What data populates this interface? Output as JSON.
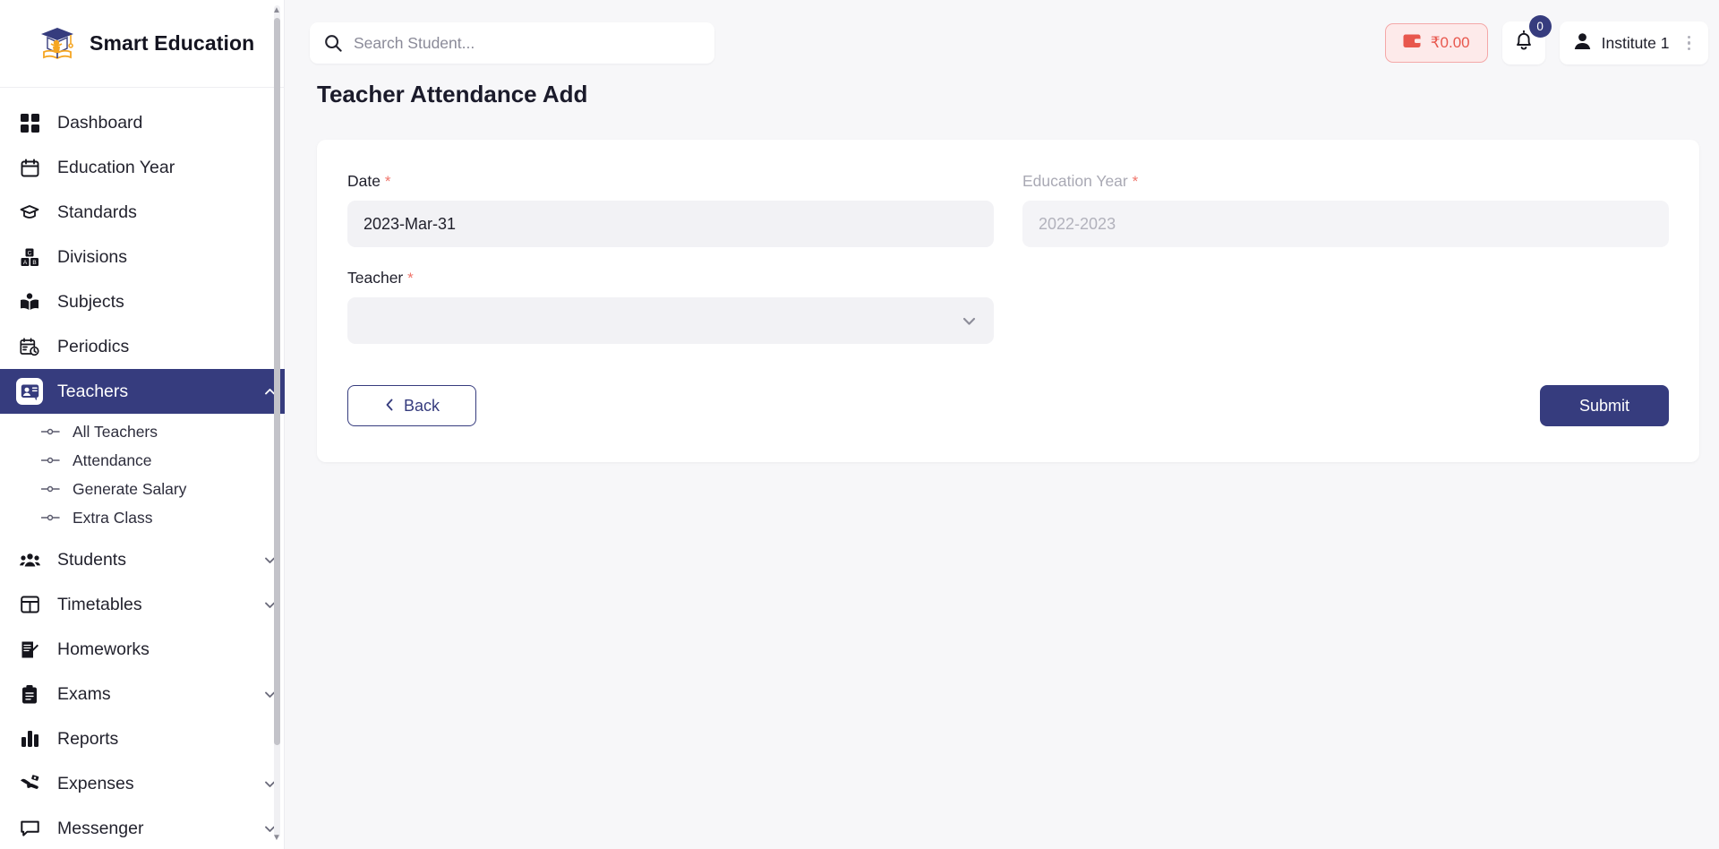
{
  "brand": {
    "title": "Smart Education",
    "logo_icon": "graduation-logo-icon"
  },
  "sidebar": {
    "items": [
      {
        "label": "Dashboard",
        "icon": "grid-icon",
        "expandable": false
      },
      {
        "label": "Education Year",
        "icon": "calendar-icon",
        "expandable": false
      },
      {
        "label": "Standards",
        "icon": "graduation-cap-icon",
        "expandable": false
      },
      {
        "label": "Divisions",
        "icon": "blocks-icon",
        "expandable": false
      },
      {
        "label": "Subjects",
        "icon": "open-book-icon",
        "expandable": false
      },
      {
        "label": "Periodics",
        "icon": "calendar-clock-icon",
        "expandable": false
      },
      {
        "label": "Teachers",
        "icon": "teacher-board-icon",
        "expandable": true,
        "active": true,
        "chevron": "chevron-up-icon"
      },
      {
        "label": "Students",
        "icon": "people-icon",
        "expandable": true,
        "chevron": "chevron-down-icon"
      },
      {
        "label": "Timetables",
        "icon": "table-icon",
        "expandable": true,
        "chevron": "chevron-down-icon"
      },
      {
        "label": "Homeworks",
        "icon": "document-pen-icon",
        "expandable": false
      },
      {
        "label": "Exams",
        "icon": "clipboard-icon",
        "expandable": true,
        "chevron": "chevron-down-icon"
      },
      {
        "label": "Reports",
        "icon": "bar-chart-icon",
        "expandable": false
      },
      {
        "label": "Expenses",
        "icon": "hand-money-icon",
        "expandable": true,
        "chevron": "chevron-down-icon"
      },
      {
        "label": "Messenger",
        "icon": "chat-bubble-icon",
        "expandable": true,
        "chevron": "chevron-down-icon"
      }
    ],
    "teachers_submenu": [
      {
        "label": "All Teachers"
      },
      {
        "label": "Attendance"
      },
      {
        "label": "Generate Salary"
      },
      {
        "label": "Extra Class"
      }
    ]
  },
  "topbar": {
    "search": {
      "placeholder": "Search Student...",
      "value": "",
      "icon": "search-icon"
    },
    "wallet": {
      "amount": "₹0.00",
      "icon": "wallet-icon"
    },
    "notifications": {
      "count": "0",
      "icon": "bell-icon"
    },
    "account": {
      "name": "Institute 1",
      "icon": "person-icon",
      "menu_icon": "kebab-menu-icon"
    }
  },
  "page": {
    "title": "Teacher Attendance Add"
  },
  "form": {
    "date": {
      "label": "Date",
      "required": "*",
      "value": "2023-Mar-31"
    },
    "education_year": {
      "label": "Education Year",
      "required": "*",
      "value": "2022-2023"
    },
    "teacher": {
      "label": "Teacher",
      "required": "*",
      "value": "",
      "chevron": "chevron-down-icon"
    },
    "back_button": {
      "label": "Back",
      "icon": "chevron-left-icon"
    },
    "submit_button": {
      "label": "Submit"
    }
  },
  "colors": {
    "accent_navy": "#363c7e",
    "wallet_red": "#e8574d",
    "required_red": "#f0756b",
    "page_bg": "#f7f7f9"
  }
}
